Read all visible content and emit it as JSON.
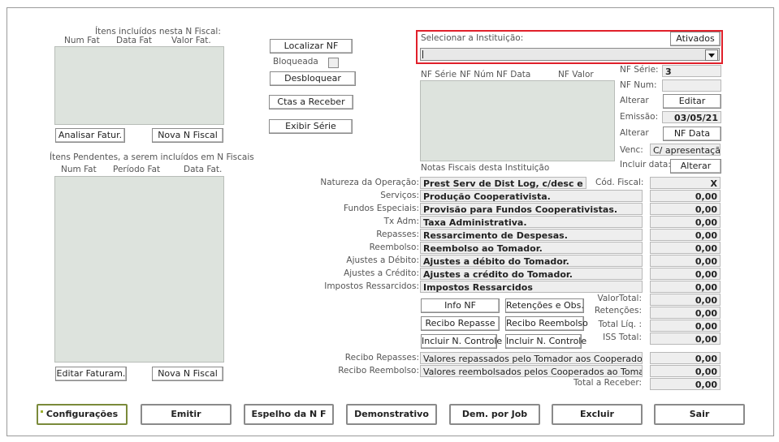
{
  "left": {
    "included_title": "Ítens incluídos nesta N Fiscal:",
    "included_cols": [
      "Num Fat",
      "Data Fat",
      "Valor Fat."
    ],
    "analisar_btn": "Analisar Fatur.",
    "nova_nf_btn": "Nova N Fiscal",
    "pending_title": "Ítens Pendentes, a serem incluídos em N Fiscais",
    "pending_cols": [
      "Num Fat",
      "Período Fat",
      "Data Fat."
    ],
    "editar_faturam_btn": "Editar Faturam.",
    "nova_nf_btn2": "Nova N Fiscal"
  },
  "middle": {
    "localizar_btn": "Localizar NF",
    "bloqueada_label": "Bloqueada",
    "desbloquear_btn": "Desbloquear",
    "ctas_btn": "Ctas a Receber",
    "exibir_serie_btn": "Exibir Série"
  },
  "institution": {
    "label": "Selecionar a Instituição:",
    "ativados_btn": "Ativados",
    "value": ""
  },
  "nf_list": {
    "cols": [
      "NF Série",
      "NF Núm",
      "NF Data",
      "NF Valor"
    ],
    "caption": "Notas Fiscais desta Instituição"
  },
  "nf_info": {
    "serie_label": "NF Série:",
    "serie_value": "3",
    "num_label": "NF Num:",
    "num_value": "",
    "alterar1_label": "Alterar",
    "editar_btn": "Editar",
    "emissao_label": "Emissão:",
    "emissao_value": "03/05/21",
    "alterar2_label": "Alterar",
    "nf_data_btn": "NF Data",
    "venc_label": "Venc:",
    "venc_value": "C/ apresentação",
    "incluir_data_label": "Incluir data:",
    "alterar_btn": "Alterar"
  },
  "natureza": {
    "label": "Natureza da Operação:",
    "value": "Prest Serv de Dist Log, c/desc e ent",
    "cod_label": "Cód. Fiscal:",
    "cod_value": "X"
  },
  "rows": [
    {
      "label": "Serviços:",
      "desc": "Produção Cooperativista.",
      "value": "0,00"
    },
    {
      "label": "Fundos Especiais:",
      "desc": "Provisão para Fundos Cooperativistas.",
      "value": "0,00"
    },
    {
      "label": "Tx Adm:",
      "desc": "Taxa Administrativa.",
      "value": "0,00"
    },
    {
      "label": "Repasses:",
      "desc": "Ressarcimento de Despesas.",
      "value": "0,00"
    },
    {
      "label": "Reembolso:",
      "desc": "Reembolso ao Tomador.",
      "value": "0,00"
    },
    {
      "label": "Ajustes a Débito:",
      "desc": "Ajustes a débito do Tomador.",
      "value": "0,00"
    },
    {
      "label": "Ajustes a Crédito:",
      "desc": "Ajustes a crédito do Tomador.",
      "value": "0,00"
    },
    {
      "label": "Impostos Ressarcidos:",
      "desc": "Impostos Ressarcidos",
      "value": "0,00"
    }
  ],
  "totals": {
    "valor_total_label": "ValorTotal:",
    "valor_total": "0,00",
    "retencoes_label": "Retenções:",
    "retencoes": "0,00",
    "total_liq_label": "Total Líq. :",
    "total_liq": "0,00",
    "iss_label": "ISS  Total:",
    "iss": "0,00"
  },
  "action_btns": {
    "info_nf": "Info NF",
    "retencoes_obs": "Retenções e Obs.",
    "recibo_repasse": "Recibo Repasse",
    "recibo_reembolso": "Recibo Reembolso",
    "incluir1": "Incluir N. Controle",
    "incluir2": "Incluir N. Controle"
  },
  "recibos": {
    "repasses_label": "Recibo   Repasses:",
    "repasses_desc": "Valores repassados pelo Tomador aos Cooperados",
    "repasses_value": "0,00",
    "reembolso_label": "Recibo Reembolso:",
    "reembolso_desc": "Valores reembolsados pelos Cooperados ao Tomador",
    "reembolso_value": "0,00",
    "total_receber_label": "Total a Receber:",
    "total_receber": "0,00"
  },
  "bottom": {
    "configuracoes": "Configurações",
    "emitir": "Emitir",
    "espelho": "Espelho da N F",
    "demonstrativo": "Demonstrativo",
    "dem_job": "Dem. por Job",
    "excluir": "Excluir",
    "sair": "Sair"
  },
  "colors": {
    "highlight": "#e0202a",
    "list_bg": "#dde3dd",
    "field_bg": "#eeeeee"
  }
}
